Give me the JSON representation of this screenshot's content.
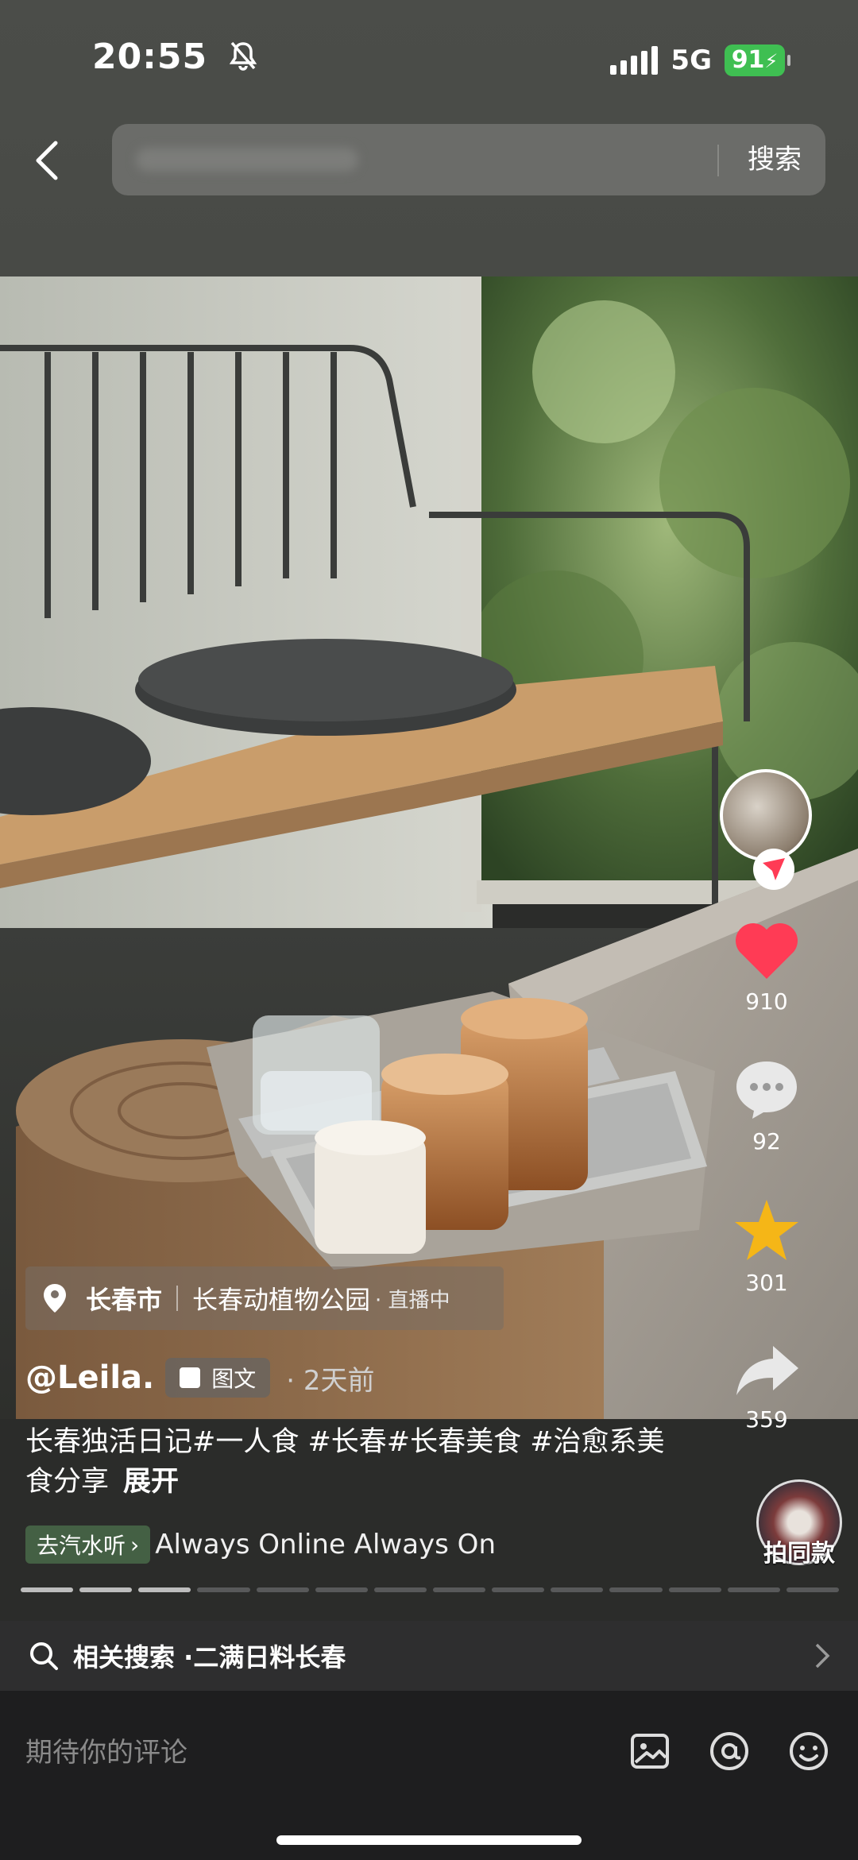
{
  "status": {
    "time": "20:55",
    "network": "5G",
    "battery": "91"
  },
  "header": {
    "search_button": "搜索"
  },
  "post": {
    "location_city": "长春市",
    "location_place": "长春动植物公园",
    "location_live": "· 直播中",
    "author": "@Leila.",
    "type_label": "图文",
    "date": "· 2天前",
    "description": "长春独活日记#一人食 #长春#长春美食 #治愈系美食分享",
    "expand_label": "展开",
    "music_button": "去汽水听",
    "music_title": "Always Online  Always Online"
  },
  "actions": {
    "likes": "910",
    "comments": "92",
    "favorites": "301",
    "shares": "359",
    "same_style_label": "拍同款"
  },
  "progress": {
    "total": 14,
    "current": 3
  },
  "related": {
    "prefix": "相关搜索 · ",
    "query": "二满日料长春"
  },
  "comment": {
    "placeholder": "期待你的评论"
  },
  "colors": {
    "like": "#ff3b55",
    "favorite": "#f5b617",
    "battery": "#3fbf52"
  }
}
